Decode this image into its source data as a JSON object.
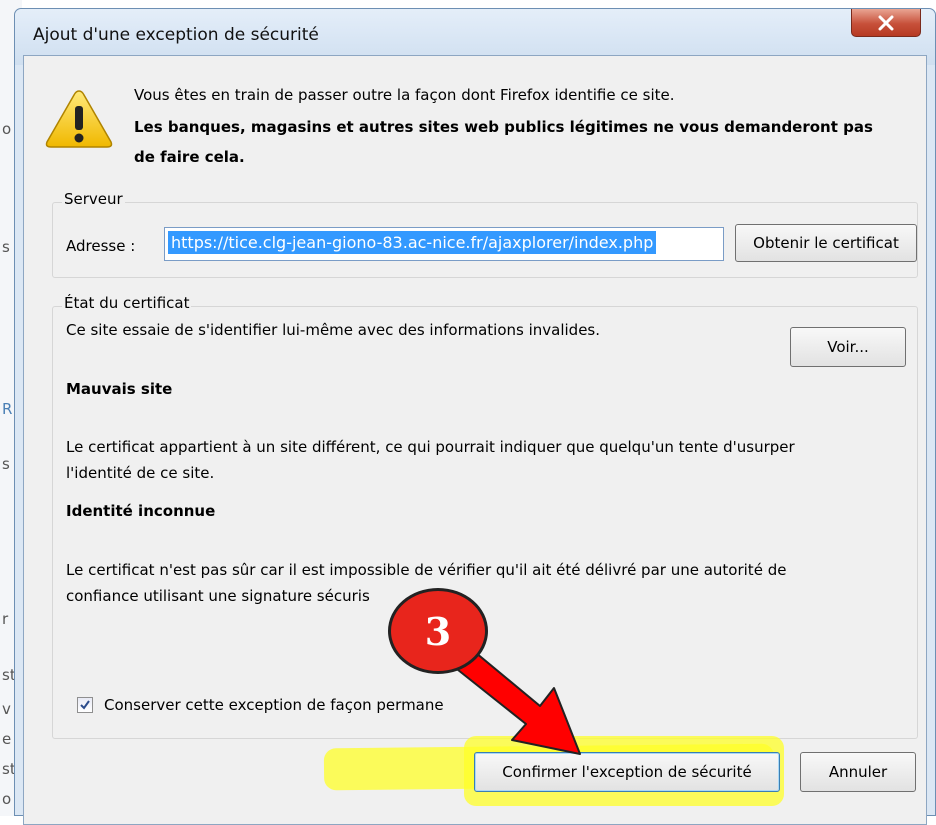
{
  "background_glyphs": [
    "o",
    "s",
    "R",
    "s",
    "r",
    "st",
    "v",
    "e",
    "st",
    "o"
  ],
  "dialog": {
    "title": "Ajout d'une exception de sécurité",
    "close_icon": "close-icon",
    "warning_icon": "warning-icon",
    "message_line1": "Vous êtes en train de passer outre la façon dont Firefox identifie ce site.",
    "message_bold_line1": "Les banques, magasins et autres sites web publics légitimes ne vous demanderont pas",
    "message_bold_line2": "de faire cela."
  },
  "server": {
    "group_label": "Serveur",
    "address_label": "Adresse :",
    "address_value": "https://tice.clg-jean-giono-83.ac-nice.fr/ajaxplorer/index.php",
    "get_cert_button": "Obtenir le certificat"
  },
  "cert_status": {
    "group_label": "État du certificat",
    "summary": "Ce site essaie de s'identifier lui-même avec des informations invalides.",
    "view_button": "Voir...",
    "issue1_title": "Mauvais site",
    "issue1_line1": "Le certificat appartient à un site différent, ce qui pourrait indiquer que quelqu'un tente d'usurper",
    "issue1_line2": "l'identité de ce site.",
    "issue2_title": "Identité inconnue",
    "issue2_line1": "Le certificat n'est pas sûr car il est impossible de vérifier qu'il ait été délivré par une autorité de",
    "issue2_line2": "confiance utilisant une signature sécuris"
  },
  "permanent_checkbox": {
    "checked": true,
    "label": "Conserver cette exception de façon permane"
  },
  "buttons": {
    "confirm": "Confirmer l'exception de sécurité",
    "cancel": "Annuler"
  },
  "annotation": {
    "step_number": "3",
    "badge_color": "#e8251c",
    "arrow_color": "#ff0000",
    "highlight_color": "#ffff28"
  }
}
